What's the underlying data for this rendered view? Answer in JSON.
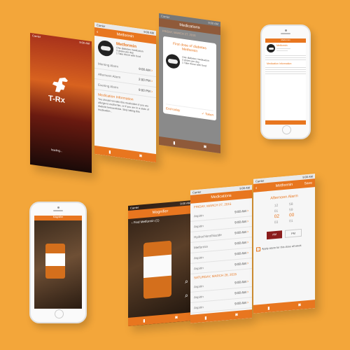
{
  "colors": {
    "background": "#F3A63A",
    "accent": "#E8761F"
  },
  "splash": {
    "logo_text": "T-Rx",
    "status_text": "loading...",
    "carrier": "Carrier",
    "time": "9:00 AM"
  },
  "detail": {
    "nav_title": "Metformin",
    "drug_name": "Metformin",
    "desc_lines": [
      "One diabetes medication",
      "3 doses per day",
      "1 Take these with food"
    ],
    "alarms": [
      {
        "label": "Morning Alarm",
        "time": "9:00 AM"
      },
      {
        "label": "Afternoon Alarm",
        "time": "2:00 PM"
      },
      {
        "label": "Evening Alarm",
        "time": "9:00 PM"
      }
    ],
    "info_title": "Medication Information",
    "info_text": "You should not take this medication if you are allergic to metformin, or if you are in a state of diabetic ketoacidosis. Stop taking this medication..."
  },
  "medications": {
    "nav_title": "Medications",
    "date_header": "FRIDAY, MARCH 27, 2015",
    "dialog_line1": "First dose of diabetes",
    "dialog_line2": "Metformin",
    "dialog_desc": [
      "One diabetes medication",
      "3 doses per day",
      "1 Take these with food"
    ],
    "end_button": "End today",
    "taken_button": "Taken",
    "rows": [
      {
        "name": "Aspirin",
        "time": "9:00 AM"
      },
      {
        "name": "Aspirin",
        "time": "9:00 AM"
      },
      {
        "name": "Hydrochlorothiazide",
        "time": "9:00 AM"
      },
      {
        "name": "Metformin",
        "time": "9:00 AM"
      },
      {
        "name": "Aspirin",
        "time": "9:00 AM"
      },
      {
        "name": "Aspirin",
        "time": "9:00 AM"
      }
    ],
    "date_header2": "SATURDAY, MARCH 28, 2015",
    "rows2": [
      {
        "name": "Aspirin",
        "time": "9:00 AM"
      },
      {
        "name": "Aspirin",
        "time": "9:00 AM"
      },
      {
        "name": "Aspirin",
        "time": "9:00 AM"
      }
    ]
  },
  "scanner": {
    "nav_title": "Magnifier",
    "prompt": "Find Metformin (1)"
  },
  "alarm_edit": {
    "nav_title": "Metformin",
    "save_label": "Save",
    "section_title": "Afternoon Alarm",
    "hours": [
      "12",
      "01",
      "02",
      "03"
    ],
    "minutes": [
      "58",
      "59",
      "00",
      "01"
    ],
    "ampm_am": "AM",
    "ampm_pm": "PM",
    "apply_label": "Apply alarm for this dose all week"
  }
}
